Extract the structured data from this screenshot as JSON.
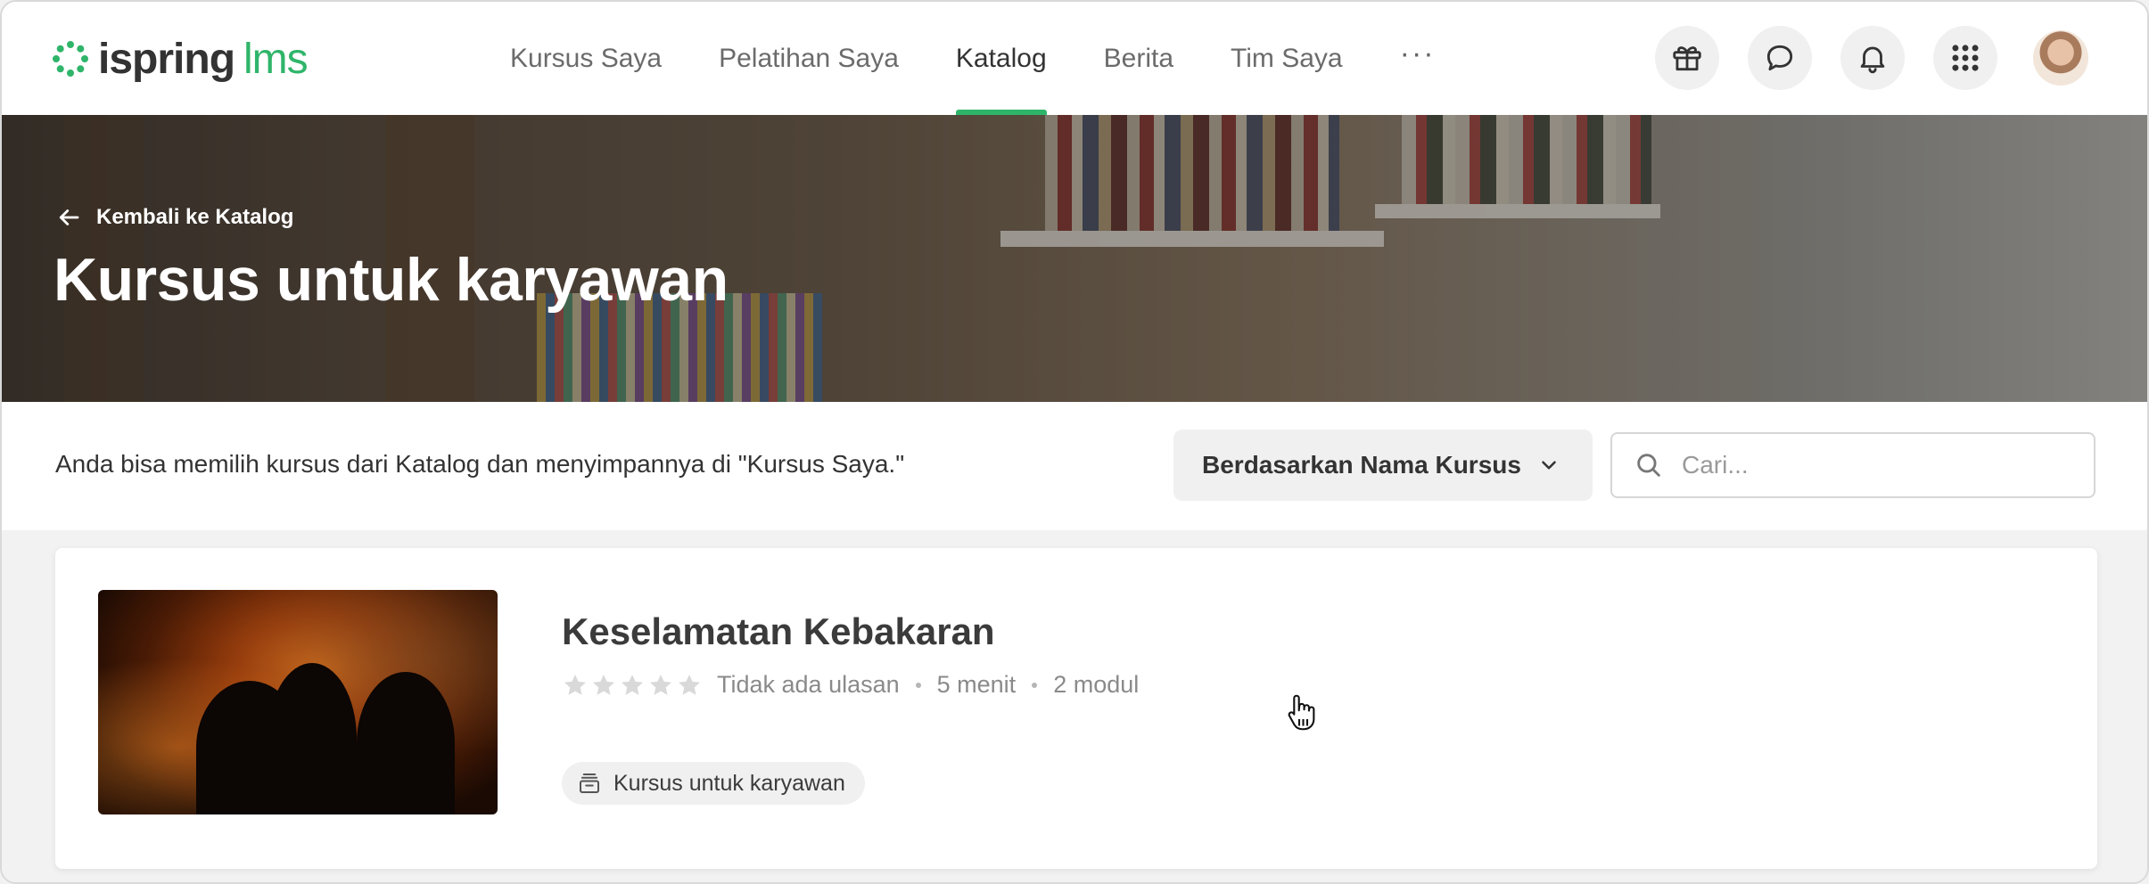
{
  "app": {
    "logo_primary": "ispring",
    "logo_secondary": "lms",
    "brand_color": "#2fb56a"
  },
  "nav": {
    "items": [
      {
        "label": "Kursus Saya",
        "active": false
      },
      {
        "label": "Pelatihan Saya",
        "active": false
      },
      {
        "label": "Katalog",
        "active": true
      },
      {
        "label": "Berita",
        "active": false
      },
      {
        "label": "Tim Saya",
        "active": false
      }
    ],
    "more_label": "···"
  },
  "actions": {
    "icons": [
      "gift-icon",
      "chat-icon",
      "bell-icon",
      "apps-grid-icon"
    ]
  },
  "hero": {
    "back_label": "Kembali ke Katalog",
    "title": "Kursus untuk karyawan"
  },
  "filter": {
    "description": "Anda bisa memilih kursus dari Katalog dan menyimpannya di \"Kursus Saya.\"",
    "sort_label": "Berdasarkan Nama Kursus",
    "search_placeholder": "Cari...",
    "search_value": ""
  },
  "courses": [
    {
      "title": "Keselamatan Kebakaran",
      "rating": 0,
      "rating_max": 5,
      "reviews_label": "Tidak ada ulasan",
      "duration": "5 menit",
      "modules": "2 modul",
      "tag": "Kursus untuk karyawan"
    }
  ]
}
